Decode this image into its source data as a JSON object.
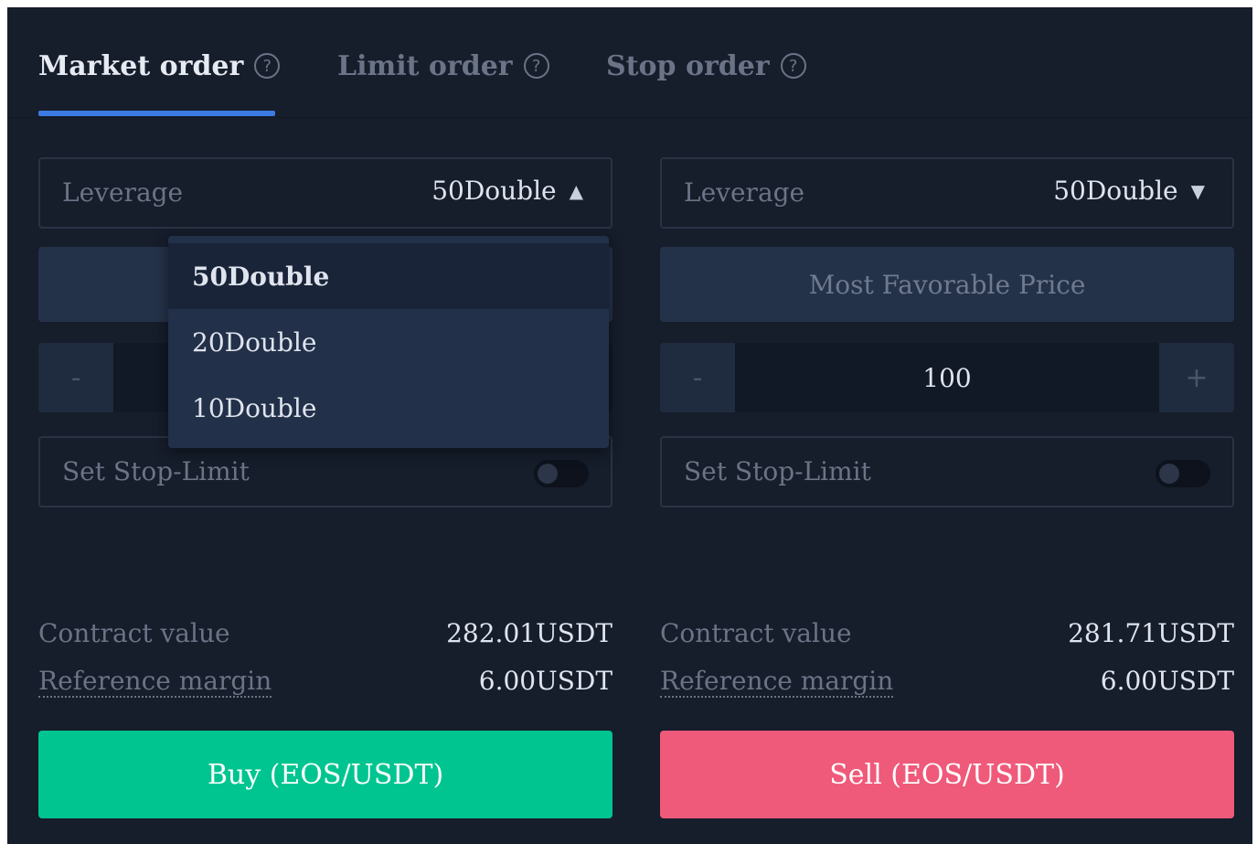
{
  "tabs": [
    {
      "label": "Market order",
      "help": "?"
    },
    {
      "label": "Limit order",
      "help": "?"
    },
    {
      "label": "Stop order",
      "help": "?"
    }
  ],
  "colors": {
    "background": "#161d2b",
    "accent": "#3b7be3",
    "buy": "#00c590",
    "sell": "#ef5a7a"
  },
  "buy_panel": {
    "leverage_label": "Leverage",
    "leverage_value": "50Double",
    "caret": "▲",
    "stepper_minus": "-",
    "stop_limit_label": "Set Stop-Limit",
    "contract_value_label": "Contract value",
    "contract_value": "282.01USDT",
    "reference_margin_label": "Reference margin",
    "reference_margin": "6.00USDT",
    "action_label": "Buy (EOS/USDT)"
  },
  "leverage_dropdown": {
    "options": [
      "50Double",
      "20Double",
      "10Double"
    ],
    "selected": "50Double"
  },
  "sell_panel": {
    "leverage_label": "Leverage",
    "leverage_value": "50Double",
    "caret": "▼",
    "price_mode": "Most Favorable Price",
    "stepper_minus": "-",
    "quantity": "100",
    "stepper_plus": "+",
    "stop_limit_label": "Set Stop-Limit",
    "contract_value_label": "Contract value",
    "contract_value": "281.71USDT",
    "reference_margin_label": "Reference margin",
    "reference_margin": "6.00USDT",
    "action_label": "Sell (EOS/USDT)"
  }
}
